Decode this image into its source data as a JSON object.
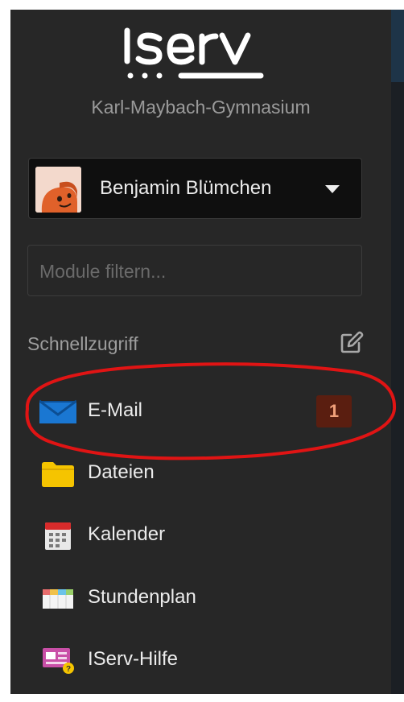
{
  "brand": {
    "logo_text": "ıserv",
    "school": "Karl-Maybach-Gymnasium"
  },
  "user": {
    "name": "Benjamin Blümchen"
  },
  "filter": {
    "placeholder": "Module filtern..."
  },
  "quick_access": {
    "title": "Schnellzugriff"
  },
  "nav": [
    {
      "label": "E-Mail",
      "icon": "mail-icon",
      "badge": "1"
    },
    {
      "label": "Dateien",
      "icon": "folder-icon"
    },
    {
      "label": "Kalender",
      "icon": "calendar-icon"
    },
    {
      "label": "Stundenplan",
      "icon": "timetable-icon"
    },
    {
      "label": "IServ-Hilfe",
      "icon": "help-icon"
    }
  ],
  "colors": {
    "sidebar_bg": "#272727",
    "badge_bg": "#5a1e10",
    "highlight": "#e01414",
    "mail_blue": "#1a77d2",
    "folder_yellow": "#f5c400"
  }
}
